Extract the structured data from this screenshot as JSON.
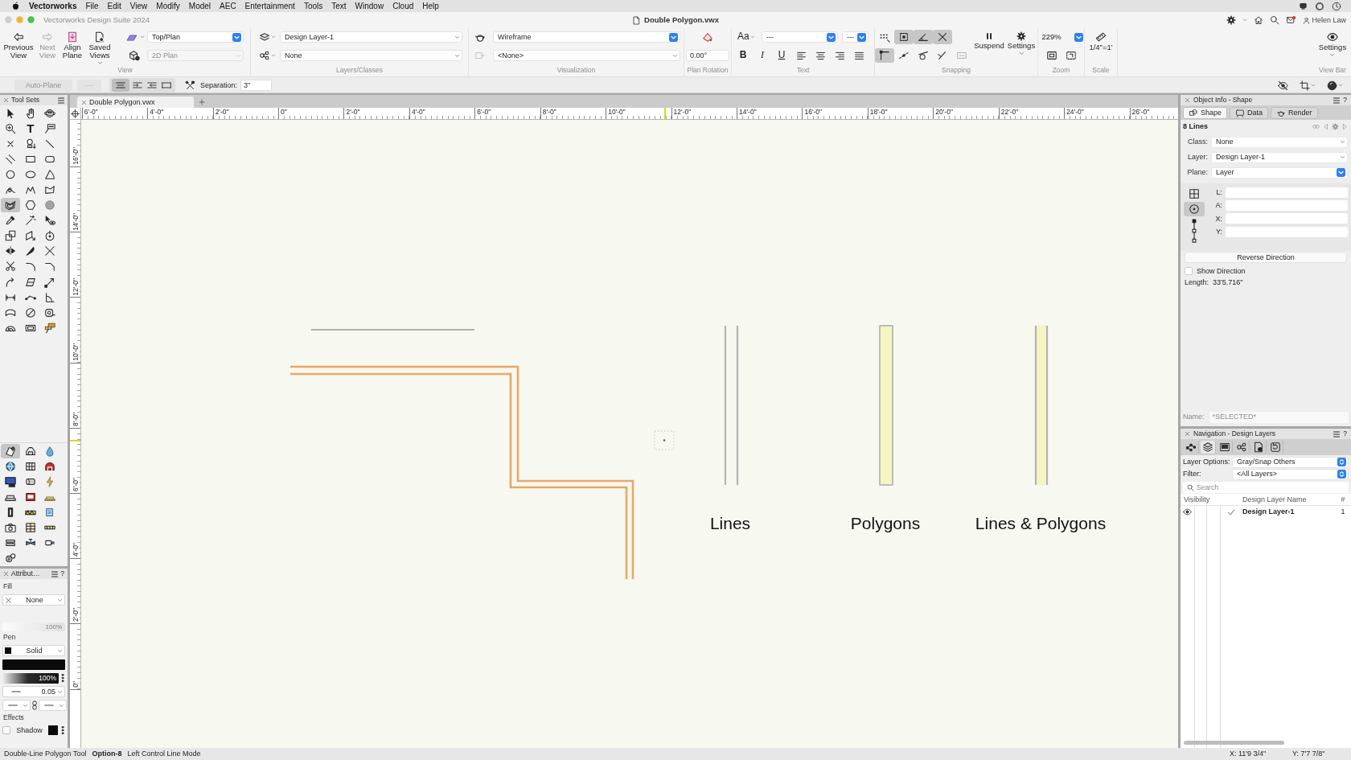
{
  "menu_bar": {
    "app": "Vectorworks",
    "items": [
      "File",
      "Edit",
      "View",
      "Modify",
      "Model",
      "AEC",
      "Entertainment",
      "Tools",
      "Text",
      "Window",
      "Cloud",
      "Help"
    ]
  },
  "title_bar": {
    "app_title": "Vectorworks Design Suite 2024",
    "document": "Double Polygon.vwx",
    "user": "Helen Law"
  },
  "toolbar": {
    "view": {
      "label": "View",
      "buttons": [
        {
          "label": "Previous View",
          "disabled": false
        },
        {
          "label": "Next View",
          "disabled": true
        },
        {
          "label": "Align Plane",
          "disabled": false
        },
        {
          "label": "Saved Views",
          "disabled": false
        }
      ],
      "standard_view": "Top/Plan",
      "working_plane": {
        "value": "2D Plan",
        "disabled": true
      }
    },
    "layers_classes": {
      "label": "Layers/Classes",
      "layer": "Design Layer-1",
      "class": "None"
    },
    "visualization": {
      "label": "Visualization",
      "render_mode": "Wireframe",
      "light_option": "<None>"
    },
    "plan_rotation": {
      "label": "Plan Rotation",
      "value": "0.00°"
    },
    "text": {
      "label": "Text",
      "style": "Aa",
      "font": "---",
      "size": "---",
      "formats": [
        "B",
        "I",
        "U"
      ]
    },
    "snapping": {
      "label": "Snapping",
      "snaps": [
        {
          "on": false,
          "disabled": false
        },
        {
          "on": true,
          "disabled": false
        },
        {
          "on": true,
          "disabled": false
        },
        {
          "on": true,
          "disabled": false
        },
        {
          "on": true,
          "disabled": false
        },
        {
          "on": false,
          "disabled": false
        },
        {
          "on": false,
          "disabled": false
        },
        {
          "on": false,
          "disabled": false
        },
        {
          "on": false,
          "disabled": true
        }
      ],
      "suspend": "Suspend",
      "settings": "Settings"
    },
    "zoom": {
      "label": "Zoom",
      "value": "229%"
    },
    "scale": {
      "label": "Scale",
      "value": "1/4\"=1'"
    },
    "view_bar": {
      "label": "View Bar",
      "settings": "Settings"
    }
  },
  "mode_bar": {
    "auto_plane": {
      "label": "Auto-Plane",
      "disabled": true
    },
    "modes": [
      {
        "selected": true
      },
      {
        "selected": false
      },
      {
        "selected": false
      },
      {
        "selected": false
      }
    ],
    "separation_label": "Separation:",
    "separation": "3\""
  },
  "tool_sets": {
    "title": "Tool Sets",
    "tools": [
      {
        "selected": false
      },
      {
        "selected": false
      },
      {
        "selected": false
      },
      {
        "selected": false
      },
      {
        "glyph": "T",
        "selected": false
      },
      {
        "selected": false
      },
      {
        "selected": false
      },
      {
        "selected": false
      },
      {
        "selected": false
      },
      {
        "selected": false
      },
      {
        "selected": false
      },
      {
        "selected": false
      },
      {
        "selected": false
      },
      {
        "selected": false
      },
      {
        "selected": false
      },
      {
        "selected": false
      },
      {
        "selected": false
      },
      {
        "selected": false
      },
      {
        "selected": true
      },
      {
        "selected": false
      },
      {
        "selected": false
      },
      {
        "selected": false
      },
      {
        "selected": false
      },
      {
        "selected": false
      },
      {
        "selected": false
      },
      {
        "selected": false
      },
      {
        "selected": false
      },
      {
        "selected": false
      },
      {
        "selected": false
      },
      {
        "selected": false
      },
      {
        "selected": false
      },
      {
        "selected": false
      },
      {
        "selected": false
      },
      {
        "selected": false
      },
      {
        "selected": false
      },
      {
        "selected": false
      },
      {
        "selected": false
      },
      {
        "selected": false
      },
      {
        "selected": false
      },
      {
        "selected": false
      },
      {
        "selected": false
      },
      {
        "selected": false
      },
      {
        "selected": false
      },
      {
        "selected": false
      },
      {
        "selected": false
      }
    ]
  },
  "tool_palette": {
    "tools": [
      {
        "selected": true
      },
      {
        "selected": false
      },
      {
        "selected": false
      },
      {
        "selected": false
      },
      {
        "selected": false
      },
      {
        "selected": false
      },
      {
        "selected": false
      },
      {
        "selected": false
      },
      {
        "selected": false
      },
      {
        "selected": false
      },
      {
        "selected": false
      },
      {
        "selected": false
      },
      {
        "selected": false
      },
      {
        "selected": false
      },
      {
        "selected": false
      },
      {
        "selected": false
      },
      {
        "selected": false
      },
      {
        "selected": false
      },
      {
        "selected": false
      },
      {
        "selected": false
      },
      {
        "selected": false
      },
      {
        "selected": false
      }
    ]
  },
  "attributes": {
    "title": "Attribut…",
    "help": "?",
    "fill_label": "Fill",
    "fill": "None",
    "fill_opacity": "100%",
    "pen_label": "Pen",
    "pen": "Solid",
    "pen_opacity": "100%",
    "line_weight": "0.05",
    "effects_label": "Effects",
    "shadow": {
      "label": "Shadow",
      "checked": false
    }
  },
  "document_tabs": [
    {
      "title": "Double Polygon.vwx"
    }
  ],
  "rulers": {
    "horizontal": [
      "6'-0\"",
      "4'-0\"",
      "2'-0\"",
      "0\"",
      "2'-0\"",
      "4'-0\"",
      "6'-0\"",
      "8'-0\"",
      "10'-0\"",
      "12'-0\"",
      "14'-0\"",
      "16'-0\"",
      "18'-0\"",
      "20'-0\"",
      "22'-0\"",
      "24'-0\"",
      "26'-0\""
    ],
    "vertical": [
      "16'-0\"",
      "14'-0\"",
      "12'-0\"",
      "10'-0\"",
      "8'-0\"",
      "6'-0\"",
      "4'-0\"",
      "2'-0\"",
      "0\""
    ]
  },
  "canvas": {
    "samples": [
      {
        "kind": "lines",
        "label": "Lines"
      },
      {
        "kind": "polygons",
        "label": "Polygons"
      },
      {
        "kind": "lines_and_polygons",
        "label": "Lines & Polygons"
      }
    ]
  },
  "object_info": {
    "title": "Object Info - Shape",
    "help": "?",
    "tabs": [
      {
        "label": "Shape",
        "selected": true
      },
      {
        "label": "Data",
        "selected": false
      },
      {
        "label": "Render",
        "selected": false
      }
    ],
    "selection": "8 Lines",
    "fields": [
      {
        "label": "Class:",
        "value": "None",
        "kind": "menu"
      },
      {
        "label": "Layer:",
        "value": "Design Layer-1",
        "kind": "menu"
      },
      {
        "label": "Plane:",
        "value": "Layer",
        "kind": "popup"
      }
    ],
    "position_modes": [
      {
        "selected": false
      },
      {
        "selected": true
      }
    ],
    "coordinates": [
      "L:",
      "A:",
      "X:",
      "Y:"
    ],
    "reverse_button": "Reverse Direction",
    "show_direction": {
      "label": "Show Direction",
      "checked": false
    },
    "length_label": "Length:",
    "length": "33'5.716\"",
    "name": {
      "label": "Name:",
      "value": "*SELECTED*",
      "disabled": true
    }
  },
  "navigation": {
    "title": "Navigation - Design Layers",
    "help": "?",
    "tabs": [
      {
        "selected": false
      },
      {
        "selected": true
      },
      {
        "selected": false
      },
      {
        "selected": false
      },
      {
        "selected": false
      },
      {
        "selected": false
      }
    ],
    "layer_options": {
      "label": "Layer Options:",
      "value": "Gray/Snap Others"
    },
    "filter": {
      "label": "Filter:",
      "value": "<All Layers>"
    },
    "search_placeholder": "Search",
    "columns": [
      "Visibility",
      "Design Layer Name",
      "#"
    ],
    "layers": [
      {
        "name": "Design Layer-1",
        "number": "1",
        "visible": true,
        "active": true
      }
    ]
  },
  "status_bar": {
    "tool": "Double-Line Polygon Tool",
    "shortcut": "Option-8",
    "mode": "Left Control Line Mode",
    "x": "X: 11'9 3/4\"",
    "y": "Y: 7'7 7/8\""
  }
}
